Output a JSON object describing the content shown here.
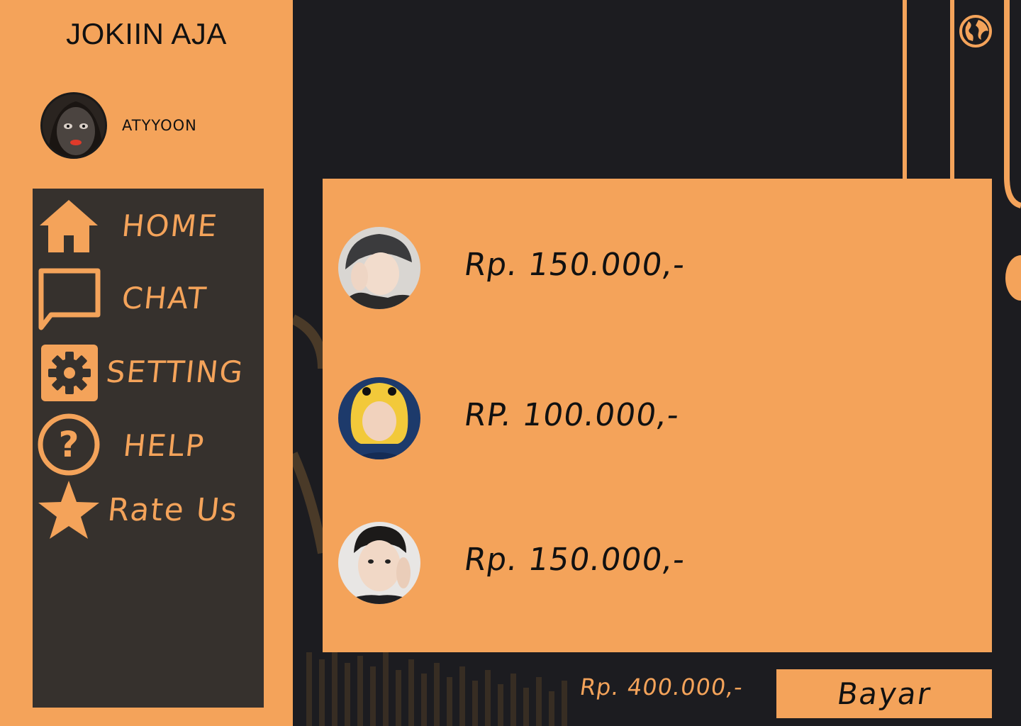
{
  "app": {
    "title": "JOKIIN AJA"
  },
  "profile": {
    "name": "ATYYOON"
  },
  "menu": {
    "items": [
      {
        "label": "HOME",
        "icon": "home-icon"
      },
      {
        "label": "CHAT",
        "icon": "chat-icon"
      },
      {
        "label": "SETTING",
        "icon": "gear-icon"
      },
      {
        "label": "HELP",
        "icon": "help-icon"
      },
      {
        "label": "Rate Us",
        "icon": "star-icon"
      }
    ]
  },
  "cart": {
    "items": [
      {
        "price": "Rp. 150.000,-"
      },
      {
        "price": "RP. 100.000,-"
      },
      {
        "price": "Rp. 150.000,-"
      }
    ]
  },
  "footer": {
    "total": "Rp. 400.000,-",
    "pay_label": "Bayar"
  },
  "colors": {
    "accent": "#f4a35a",
    "panel": "#36312d",
    "background": "#1c1c20"
  }
}
